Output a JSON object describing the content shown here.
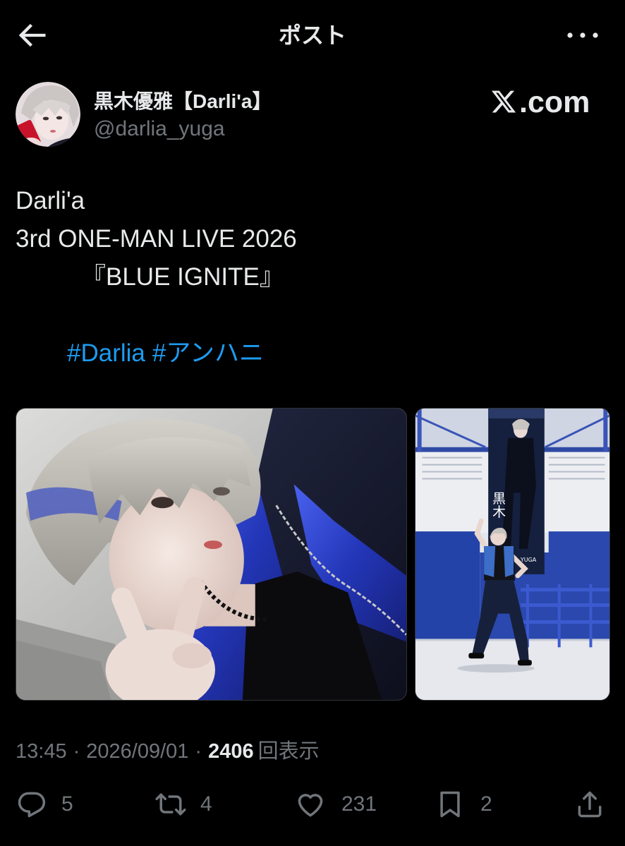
{
  "header": {
    "title": "ポスト",
    "back_icon": "arrow-left-icon",
    "more_icon": "more-dots-icon"
  },
  "author": {
    "name": "黒木優雅【Darli'a】",
    "handle": "@darlia_yuga"
  },
  "watermark": {
    "logo": "X.com",
    "suffix": ".com"
  },
  "post": {
    "lines": [
      "Darli'a",
      "3rd ONE-MAN LIVE 2026",
      "『BLUE IGNITE』"
    ],
    "hashtags": [
      "#Darlia",
      "#アンハニ"
    ]
  },
  "media": {
    "banner_kanji": "黒木",
    "banner_name": "YUGA"
  },
  "meta": {
    "time": "13:45",
    "separator": "·",
    "date": "2026/09/01",
    "views": "2406",
    "views_label": "回表示"
  },
  "actions": [
    {
      "icon": "reply-icon",
      "count": "5"
    },
    {
      "icon": "repost-icon",
      "count": "4"
    },
    {
      "icon": "like-icon",
      "count": "231"
    },
    {
      "icon": "bookmark-icon",
      "count": "2"
    },
    {
      "icon": "share-icon"
    }
  ],
  "colors": {
    "background": "#000000",
    "text": "#e7e9ea",
    "secondary": "#71767b",
    "link": "#1d9bf0",
    "border": "#2f3336"
  }
}
